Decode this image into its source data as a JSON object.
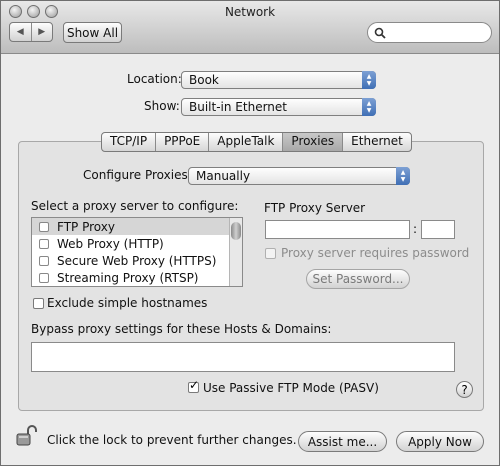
{
  "window": {
    "title": "Network"
  },
  "toolbar": {
    "back_icon": "back-icon",
    "forward_icon": "forward-icon",
    "show_all_label": "Show All",
    "search_placeholder": ""
  },
  "location": {
    "label": "Location:",
    "value": "Book"
  },
  "show": {
    "label": "Show:",
    "value": "Built-in Ethernet"
  },
  "tabs": [
    {
      "label": "TCP/IP",
      "selected": false
    },
    {
      "label": "PPPoE",
      "selected": false
    },
    {
      "label": "AppleTalk",
      "selected": false
    },
    {
      "label": "Proxies",
      "selected": true
    },
    {
      "label": "Ethernet",
      "selected": false
    }
  ],
  "configure": {
    "label": "Configure Proxies:",
    "value": "Manually"
  },
  "proxy_list": {
    "label": "Select a proxy server to configure:",
    "items": [
      {
        "label": "FTP Proxy",
        "checked": false,
        "selected": true
      },
      {
        "label": "Web Proxy (HTTP)",
        "checked": false,
        "selected": false
      },
      {
        "label": "Secure Web Proxy (HTTPS)",
        "checked": false,
        "selected": false
      },
      {
        "label": "Streaming Proxy (RTSP)",
        "checked": false,
        "selected": false
      }
    ]
  },
  "ftp_server": {
    "label": "FTP Proxy Server",
    "host": "",
    "port": "",
    "separator": ":"
  },
  "password": {
    "checkbox_label": "Proxy server requires password",
    "enabled": false,
    "button_label": "Set Password..."
  },
  "exclude": {
    "label": "Exclude simple hostnames",
    "checked": false
  },
  "bypass": {
    "label": "Bypass proxy settings for these Hosts & Domains:",
    "value": ""
  },
  "passive": {
    "label": "Use Passive FTP Mode (PASV)",
    "checked": true
  },
  "help": {
    "label": "?"
  },
  "footer": {
    "lock_text": "Click the lock to prevent further changes.",
    "lock_icon": "lock-icon",
    "assist_label": "Assist me...",
    "apply_label": "Apply Now"
  },
  "colors": {
    "accent": "#3f6fb5",
    "window_bg": "#ececec",
    "panel_bg": "#e3e3e3"
  }
}
